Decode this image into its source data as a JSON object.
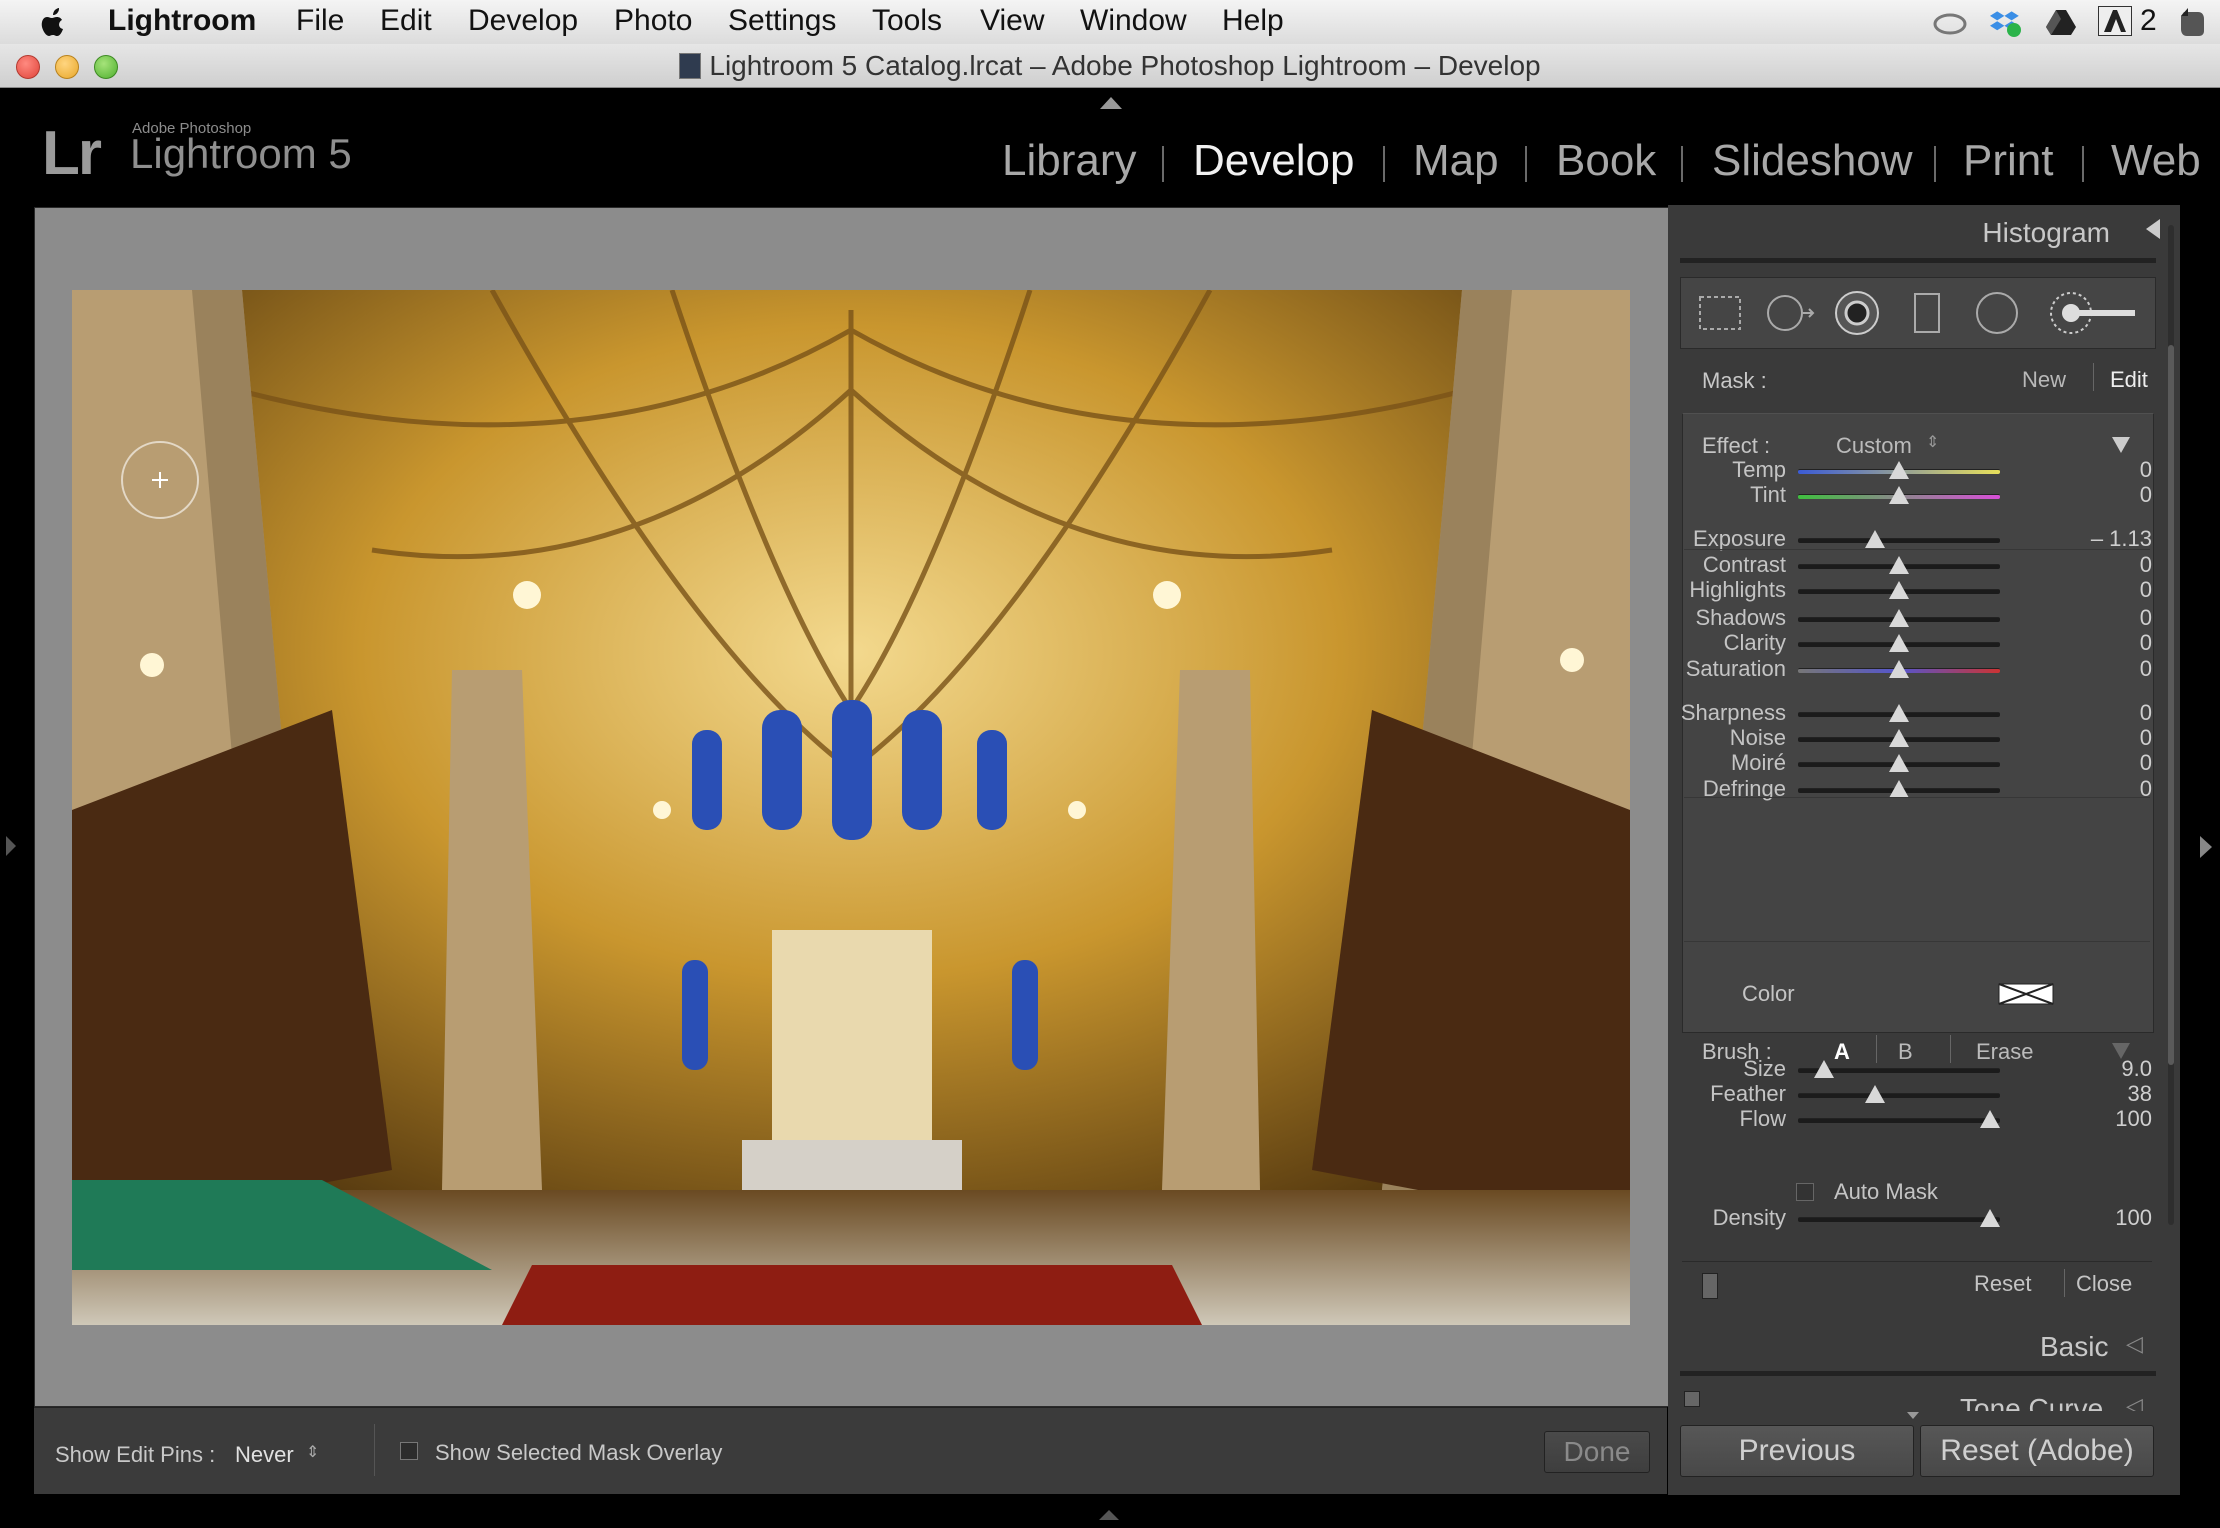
{
  "menubar": {
    "app": "Lightroom",
    "items": [
      "File",
      "Edit",
      "Develop",
      "Photo",
      "Settings",
      "Tools",
      "View",
      "Window",
      "Help"
    ],
    "status_count": "2"
  },
  "window": {
    "title": "Lightroom 5 Catalog.lrcat – Adobe Photoshop Lightroom – Develop"
  },
  "header": {
    "logo_mark": "Lr",
    "brand_small": "Adobe Photoshop",
    "brand": "Lightroom 5",
    "modules": [
      "Library",
      "Develop",
      "Map",
      "Book",
      "Slideshow",
      "Print",
      "Web"
    ],
    "active_module": "Develop"
  },
  "panel": {
    "histogram": "Histogram",
    "mask": {
      "label": "Mask :",
      "new": "New",
      "edit": "Edit"
    },
    "effect": {
      "label": "Effect :",
      "preset": "Custom"
    },
    "sliders": [
      {
        "name": "Temp",
        "value": "0",
        "pos": 0.5
      },
      {
        "name": "Tint",
        "value": "0",
        "pos": 0.5
      },
      {
        "name": "Exposure",
        "value": "– 1.13",
        "pos": 0.38
      },
      {
        "name": "Contrast",
        "value": "0",
        "pos": 0.5
      },
      {
        "name": "Highlights",
        "value": "0",
        "pos": 0.5
      },
      {
        "name": "Shadows",
        "value": "0",
        "pos": 0.5
      },
      {
        "name": "Clarity",
        "value": "0",
        "pos": 0.5
      },
      {
        "name": "Saturation",
        "value": "0",
        "pos": 0.5
      },
      {
        "name": "Sharpness",
        "value": "0",
        "pos": 0.5
      },
      {
        "name": "Noise",
        "value": "0",
        "pos": 0.5
      },
      {
        "name": "Moiré",
        "value": "0",
        "pos": 0.5
      },
      {
        "name": "Defringe",
        "value": "0",
        "pos": 0.5
      }
    ],
    "color_label": "Color",
    "brush": {
      "label": "Brush :",
      "a": "A",
      "b": "B",
      "erase": "Erase"
    },
    "brush_sliders": [
      {
        "name": "Size",
        "value": "9.0",
        "pos": 0.13
      },
      {
        "name": "Feather",
        "value": "38",
        "pos": 0.38
      },
      {
        "name": "Flow",
        "value": "100",
        "pos": 0.95
      }
    ],
    "auto_mask": "Auto Mask",
    "density": {
      "name": "Density",
      "value": "100",
      "pos": 0.95
    },
    "reset": "Reset",
    "close": "Close",
    "basic": "Basic",
    "tone_curve": "Tone Curve",
    "previous": "Previous",
    "reset_adobe": "Reset (Adobe)"
  },
  "toolbar": {
    "show_pins_label": "Show Edit Pins :",
    "show_pins_value": "Never",
    "overlay_label": "Show Selected Mask Overlay",
    "done": "Done"
  }
}
